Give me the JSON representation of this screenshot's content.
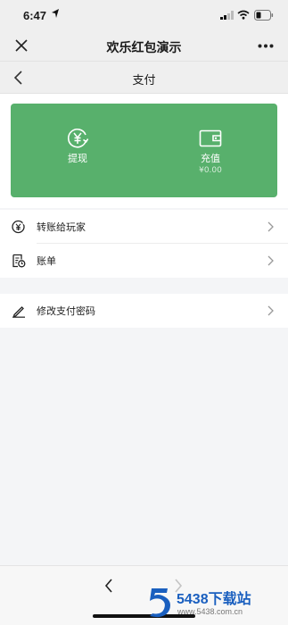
{
  "status_bar": {
    "time": "6:47"
  },
  "app_bar": {
    "title": "欢乐红包演示"
  },
  "nav": {
    "title": "支付"
  },
  "wallet": {
    "withdraw": {
      "label": "提现",
      "icon": "yen-refresh-icon"
    },
    "recharge": {
      "label": "充值",
      "balance": "¥0.00",
      "icon": "wallet-icon"
    }
  },
  "menu": {
    "group1": [
      {
        "label": "转账给玩家",
        "icon": "yen-transfer-icon"
      },
      {
        "label": "账单",
        "icon": "bill-icon"
      }
    ],
    "group2": [
      {
        "label": "修改支付密码",
        "icon": "pencil-icon"
      }
    ]
  },
  "watermark": {
    "title": "5438下载站",
    "url": "www.5438.com.cn"
  },
  "colors": {
    "card": "#58b06c",
    "background": "#f4f5f7",
    "bar": "#efefef",
    "watermark": "#1a5fbf"
  }
}
